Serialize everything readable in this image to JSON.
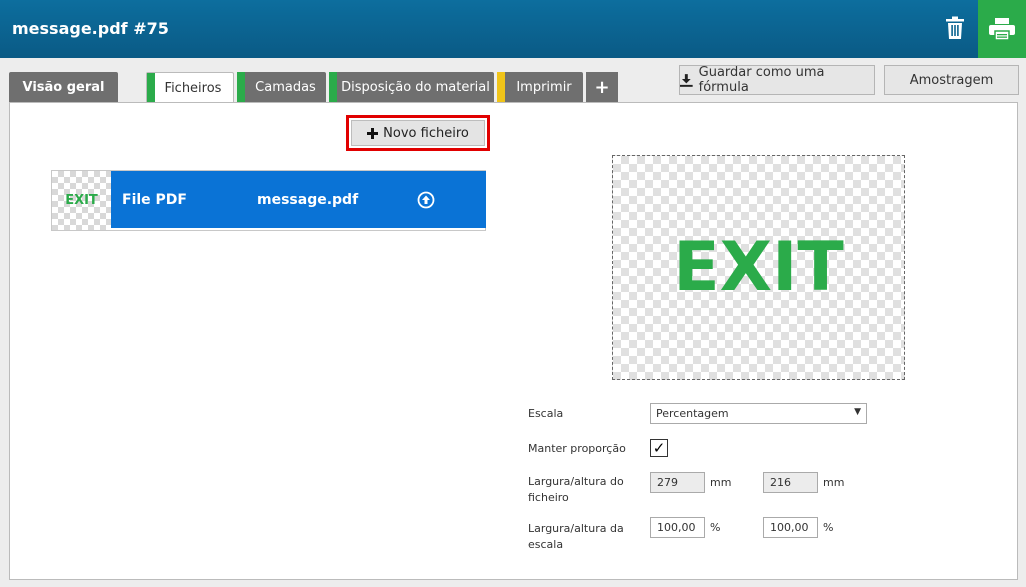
{
  "header": {
    "title": "message.pdf #75"
  },
  "tabs": [
    {
      "label": "Visão geral",
      "accent": ""
    },
    {
      "label": "Ficheiros",
      "accent": "#2bab4a"
    },
    {
      "label": "Camadas",
      "accent": "#2bab4a"
    },
    {
      "label": "Disposição do material",
      "accent": "#2bab4a"
    },
    {
      "label": "Imprimir",
      "accent": "#f0c419"
    }
  ],
  "tab_add": "+",
  "toolbar": {
    "save_formula": "Guardar como uma fórmula",
    "sampling": "Amostragem"
  },
  "new_file_label": "Novo ficheiro",
  "file": {
    "thumb_text": "EXIT",
    "type": "File PDF",
    "name": "message.pdf"
  },
  "preview_text": "EXIT",
  "form": {
    "scale_label": "Escala",
    "scale_value": "Percentagem",
    "keep_ratio_label": "Manter proporção",
    "keep_ratio_checked": "✓",
    "file_size_label_1": "Largura/altura do",
    "file_size_label_2": "ficheiro",
    "file_width": "279",
    "file_height": "216",
    "file_unit": "mm",
    "scale_size_label_1": "Largura/altura da",
    "scale_size_label_2": "escala",
    "scale_width": "100,00",
    "scale_height": "100,00",
    "scale_unit": "%"
  },
  "colors": {
    "header": "#0a5a85",
    "print": "#2bab4a",
    "file_row": "#0a73d6",
    "highlight": "#e10000"
  },
  "icons": {
    "trash": "trash-icon",
    "print": "printer-icon",
    "download": "download-icon",
    "plus": "plus-icon",
    "upload": "upload-circle-icon",
    "dropdown": "dropdown-arrow-icon"
  }
}
